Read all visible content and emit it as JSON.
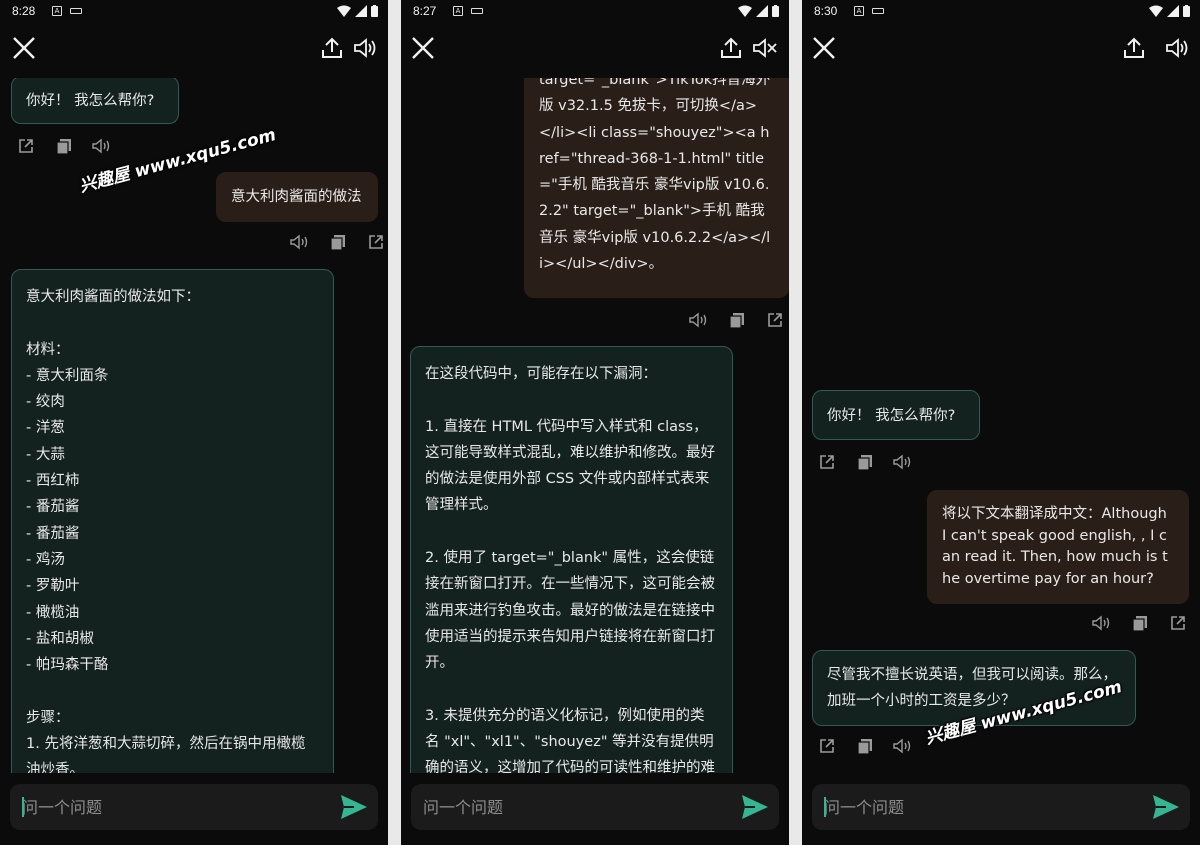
{
  "screens": [
    {
      "time": "8:28",
      "volume_muted": false,
      "input_placeholder": "问一个问题",
      "messages": [
        {
          "role": "bot",
          "text": "你好！ 我怎么帮你?"
        },
        {
          "role": "user",
          "text": "意大利肉酱面的做法"
        },
        {
          "role": "bot",
          "text": "意大利肉酱面的做法如下：\n\n材料：\n- 意大利面条\n- 绞肉\n- 洋葱\n- 大蒜\n- 西红柿\n- 番茄酱\n- 番茄酱\n- 鸡汤\n- 罗勒叶\n- 橄榄油\n- 盐和胡椒\n- 帕玛森干酪\n\n步骤：\n1. 先将洋葱和大蒜切碎，然后在锅中用橄榄油炒香。"
        }
      ],
      "watermark": "兴趣屋 www.xqu5.com"
    },
    {
      "time": "8:27",
      "volume_muted": true,
      "input_placeholder": "问一个问题",
      "messages": [
        {
          "role": "user",
          "text": "target=\"_blank\">TikTok抖音海外版 v32.1.5 免拔卡，可切换</a></li><li class=\"shouyez\"><a href=\"thread-368-1-1.html\" title=\"手机 酷我音乐 豪华vip版 v10.6.2.2\" target=\"_blank\">手机 酷我音乐 豪华vip版 v10.6.2.2</a></li></ul></div>。"
        },
        {
          "role": "bot",
          "text": "在这段代码中，可能存在以下漏洞：\n\n1. 直接在 HTML 代码中写入样式和 class，这可能导致样式混乱，难以维护和修改。最好的做法是使用外部 CSS 文件或内部样式表来管理样式。\n\n2. 使用了 target=\"_blank\" 属性，这会使链接在新窗口打开。在一些情况下，这可能会被滥用来进行钓鱼攻击。最好的做法是在链接中使用适当的提示来告知用户链接将在新窗口打开。\n\n3. 未提供充分的语义化标记，例如使用的类名 \"xl\"、\"xl1\"、\"shouyez\" 等并没有提供明确的语义，这增加了代码的可读性和维护的难度。最好的做法是使用具有明确语义的类名"
        }
      ]
    },
    {
      "time": "8:30",
      "volume_muted": false,
      "input_placeholder": "问一个问题",
      "messages": [
        {
          "role": "bot",
          "text": "你好！ 我怎么帮你?"
        },
        {
          "role": "user",
          "text": "将以下文本翻译成中文：Although I can't speak good english, , I can read it. Then, how much is the overtime pay for an hour?"
        },
        {
          "role": "bot",
          "text": "尽管我不擅长说英语，但我可以阅读。那么，加班一个小时的工资是多少？"
        }
      ],
      "watermark": "兴趣屋 www.xqu5.com"
    }
  ],
  "icons": {
    "close": "close-icon",
    "share": "share-icon",
    "volume": "volume-icon",
    "volume_off": "volume-off-icon",
    "copy": "copy-icon",
    "open_external": "open-external-icon",
    "send": "send-icon"
  },
  "colors": {
    "background": "#0b0b0b",
    "bot_bubble": "#13211f",
    "bot_border": "#2f5b52",
    "user_bubble": "#2a1f18",
    "accent": "#35b591",
    "input_bg": "#1b1b1b"
  }
}
